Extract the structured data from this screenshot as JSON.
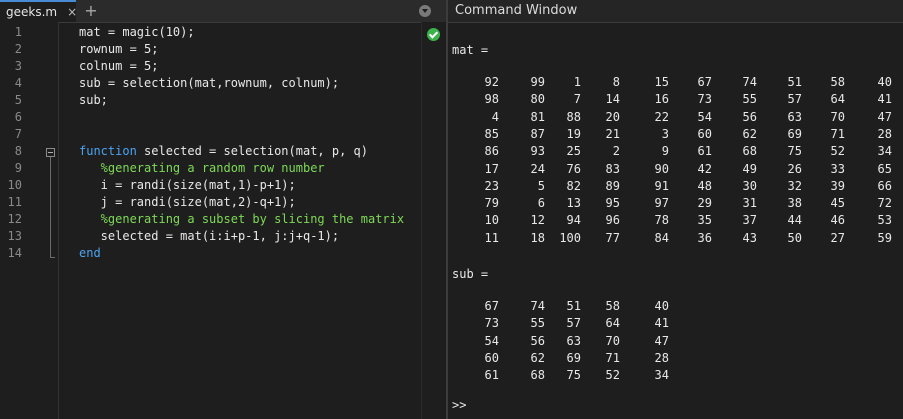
{
  "editor": {
    "tab": {
      "label": "geeks.m",
      "close": "×"
    },
    "add_tab": "+",
    "lines": [
      {
        "n": "1",
        "segs": [
          {
            "t": "mat = magic(10);",
            "c": ""
          }
        ]
      },
      {
        "n": "2",
        "segs": [
          {
            "t": "rownum = 5;",
            "c": ""
          }
        ]
      },
      {
        "n": "3",
        "segs": [
          {
            "t": "colnum = 5;",
            "c": ""
          }
        ]
      },
      {
        "n": "4",
        "segs": [
          {
            "t": "sub = selection(mat,rownum, colnum);",
            "c": ""
          }
        ]
      },
      {
        "n": "5",
        "segs": [
          {
            "t": "sub;",
            "c": ""
          }
        ]
      },
      {
        "n": "6",
        "segs": []
      },
      {
        "n": "7",
        "segs": []
      },
      {
        "n": "8",
        "segs": [
          {
            "t": "function",
            "c": "kw"
          },
          {
            "t": " selected = selection(mat, p, q)",
            "c": ""
          }
        ]
      },
      {
        "n": "9",
        "segs": [
          {
            "t": "   %generating a random row number",
            "c": "cm"
          }
        ]
      },
      {
        "n": "10",
        "segs": [
          {
            "t": "   i = randi(size(mat,1)-p+1);",
            "c": ""
          }
        ]
      },
      {
        "n": "11",
        "segs": [
          {
            "t": "   j = randi(size(mat,2)-q+1);",
            "c": ""
          }
        ]
      },
      {
        "n": "12",
        "segs": [
          {
            "t": "   %generating a subset by slicing the matrix",
            "c": "cm"
          }
        ]
      },
      {
        "n": "13",
        "segs": [
          {
            "t": "   selected = mat(i:i+p-1, j:j+q-1);",
            "c": ""
          }
        ]
      },
      {
        "n": "14",
        "segs": [
          {
            "t": "end",
            "c": "kw"
          }
        ]
      }
    ]
  },
  "command_window": {
    "title": "Command Window",
    "mat_label": "mat =",
    "mat": [
      [
        92,
        99,
        1,
        8,
        15,
        67,
        74,
        51,
        58,
        40
      ],
      [
        98,
        80,
        7,
        14,
        16,
        73,
        55,
        57,
        64,
        41
      ],
      [
        4,
        81,
        88,
        20,
        22,
        54,
        56,
        63,
        70,
        47
      ],
      [
        85,
        87,
        19,
        21,
        3,
        60,
        62,
        69,
        71,
        28
      ],
      [
        86,
        93,
        25,
        2,
        9,
        61,
        68,
        75,
        52,
        34
      ],
      [
        17,
        24,
        76,
        83,
        90,
        42,
        49,
        26,
        33,
        65
      ],
      [
        23,
        5,
        82,
        89,
        91,
        48,
        30,
        32,
        39,
        66
      ],
      [
        79,
        6,
        13,
        95,
        97,
        29,
        31,
        38,
        45,
        72
      ],
      [
        10,
        12,
        94,
        96,
        78,
        35,
        37,
        44,
        46,
        53
      ],
      [
        11,
        18,
        100,
        77,
        84,
        36,
        43,
        50,
        27,
        59
      ]
    ],
    "sub_label": "sub =",
    "sub": [
      [
        67,
        74,
        51,
        58,
        40
      ],
      [
        73,
        55,
        57,
        64,
        41
      ],
      [
        54,
        56,
        63,
        70,
        47
      ],
      [
        60,
        62,
        69,
        71,
        28
      ],
      [
        61,
        68,
        75,
        52,
        34
      ]
    ],
    "prompt": ">>"
  }
}
